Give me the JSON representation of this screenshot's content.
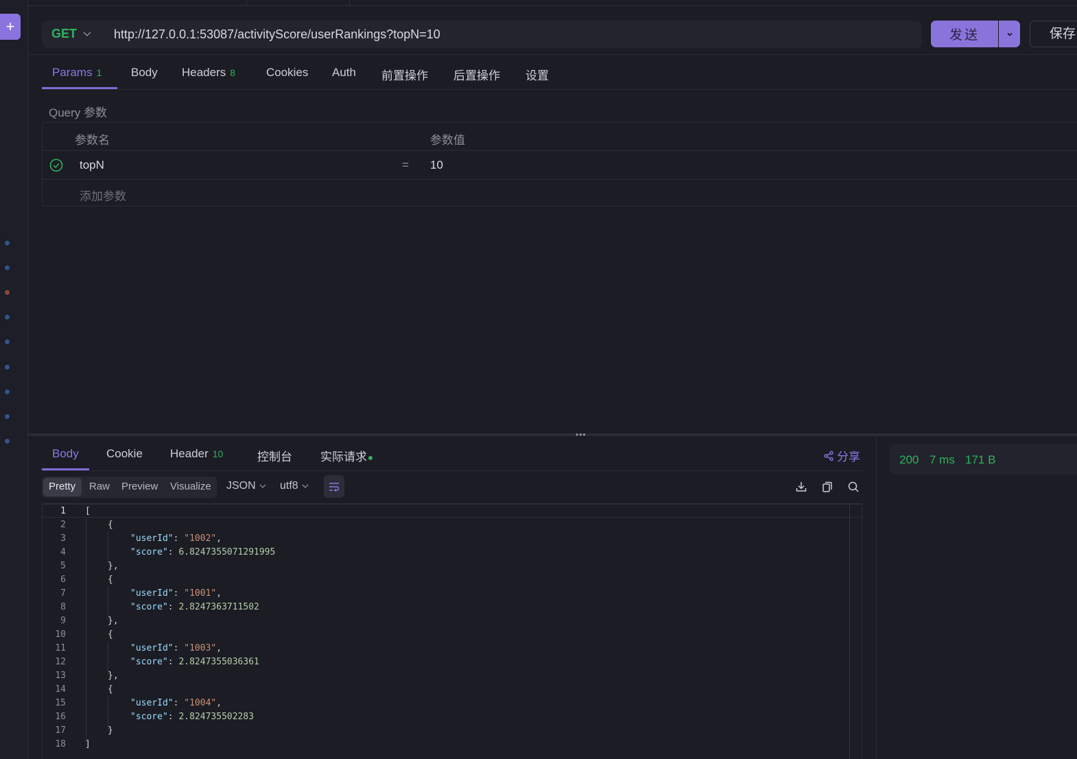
{
  "request": {
    "method": "GET",
    "url": "http://127.0.0.1:53087/activityScore/userRankings?topN=10",
    "send_label": "发送",
    "save_label": "保存"
  },
  "request_tabs": [
    {
      "label": "Params",
      "badge": "1"
    },
    {
      "label": "Body"
    },
    {
      "label": "Headers",
      "badge": "8"
    },
    {
      "label": "Cookies"
    },
    {
      "label": "Auth"
    },
    {
      "label": "前置操作"
    },
    {
      "label": "后置操作"
    },
    {
      "label": "设置"
    }
  ],
  "params": {
    "section_label": "Query 参数",
    "col_name": "参数名",
    "col_value": "参数值",
    "rows": [
      {
        "name": "topN",
        "eq": "=",
        "value": "10",
        "enabled": true
      }
    ],
    "add_placeholder": "添加参数"
  },
  "response_tabs": [
    {
      "label": "Body"
    },
    {
      "label": "Cookie"
    },
    {
      "label": "Header",
      "badge": "10"
    },
    {
      "label": "控制台"
    },
    {
      "label": "实际请求"
    }
  ],
  "share_label": "分享",
  "status": {
    "code": "200",
    "time": "7 ms",
    "size": "171 B"
  },
  "view_modes": [
    "Pretty",
    "Raw",
    "Preview",
    "Visualize"
  ],
  "format": "JSON",
  "encoding": "utf8",
  "code_lines": [
    "1",
    "2",
    "3",
    "4",
    "5",
    "6",
    "7",
    "8",
    "9",
    "10",
    "11",
    "12",
    "13",
    "14",
    "15",
    "16",
    "17",
    "18"
  ],
  "response_json": [
    {
      "userId": "1002",
      "score": "6.8247355071291995"
    },
    {
      "userId": "1001",
      "score": "2.8247363711502"
    },
    {
      "userId": "1003",
      "score": "2.8247355036361"
    },
    {
      "userId": "1004",
      "score": "2.824735502283"
    }
  ],
  "colors": {
    "accent": "#8b74df",
    "success": "#2fb35d"
  }
}
